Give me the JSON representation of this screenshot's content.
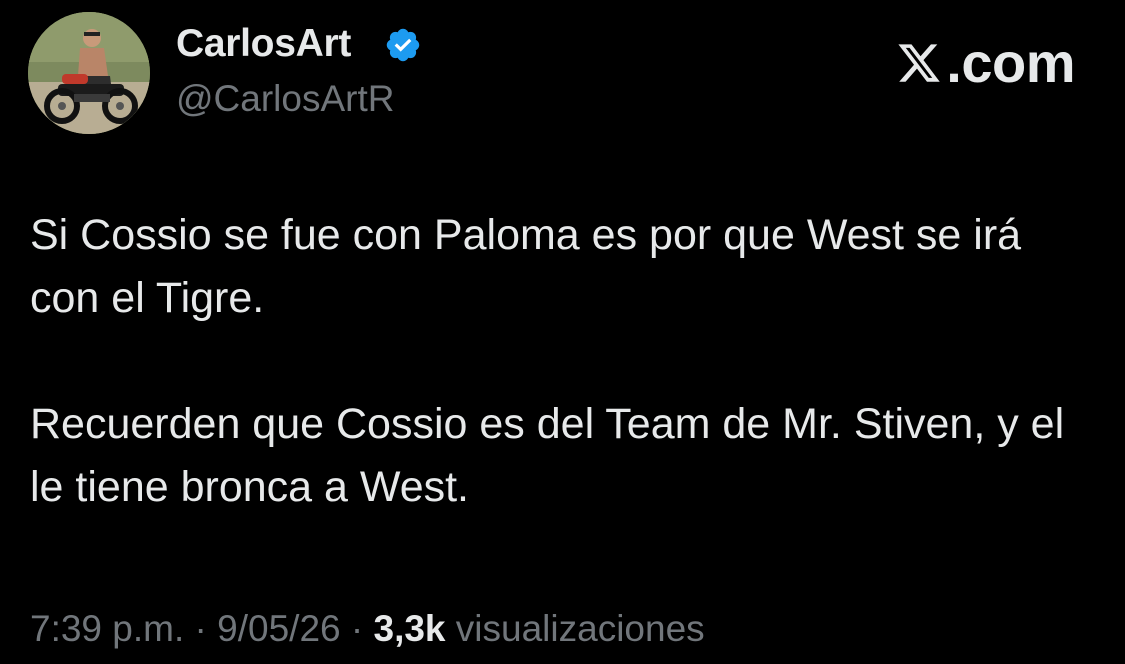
{
  "author": {
    "display_name": "CarlosArt",
    "handle": "@CarlosArtR",
    "verified": true,
    "verified_badge_color": "#1d9bf0",
    "avatar_icon": "profile-photo-motorcycle"
  },
  "watermark": {
    "label": ".com",
    "icon": "x-logo-icon"
  },
  "tweet": {
    "paragraphs": [
      "Si Cossio se fue con Paloma es por que West se irá con el Tigre.",
      "Recuerden que Cossio es del Team de Mr. Stiven, y el le tiene bronca a West."
    ]
  },
  "meta": {
    "time": "7:39 p.m.",
    "separator": " · ",
    "date": "9/05/26",
    "views_count": "3,3k",
    "views_label": "visualizaciones"
  },
  "colors": {
    "background": "#000000",
    "primary_text": "#e7e9ea",
    "secondary_text": "#71767b"
  }
}
